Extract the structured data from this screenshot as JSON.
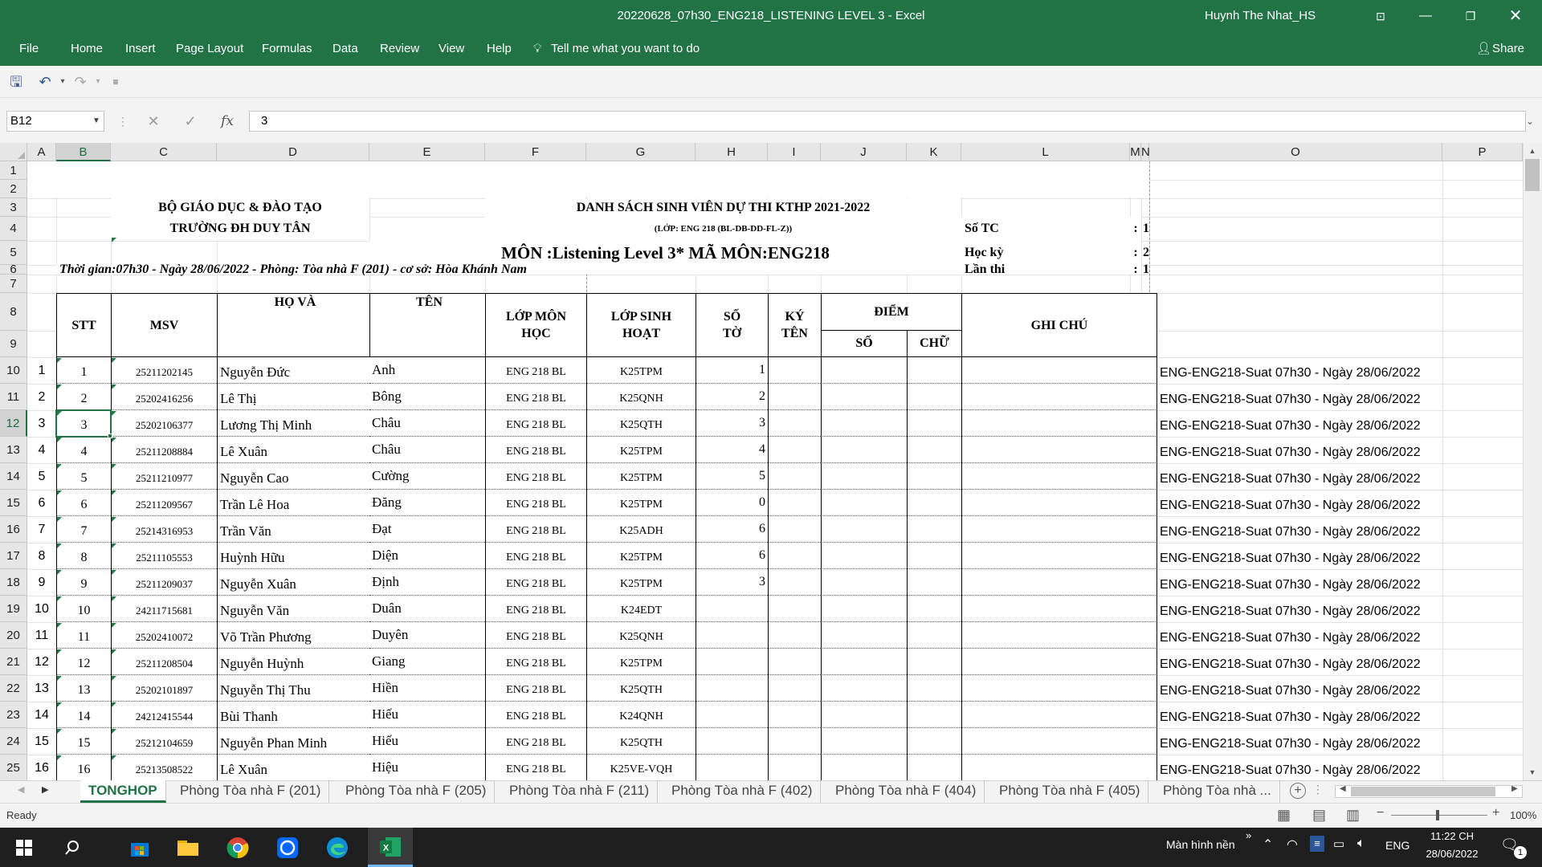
{
  "app": {
    "title": "20220628_07h30_ENG218_LISTENING LEVEL 3  -  Excel",
    "user": "Huynh The Nhat_HS",
    "share_label": "Share",
    "tabs": [
      "File",
      "Home",
      "Insert",
      "Page Layout",
      "Formulas",
      "Data",
      "Review",
      "View",
      "Help"
    ],
    "tell_me": "Tell me what you want to do"
  },
  "formula_bar": {
    "name_box": "B12",
    "formula": "3"
  },
  "columns": [
    "A",
    "B",
    "C",
    "D",
    "E",
    "F",
    "G",
    "H",
    "I",
    "J",
    "K",
    "L",
    "M",
    "N",
    "O",
    "P"
  ],
  "rows": [
    "1",
    "2",
    "3",
    "4",
    "5",
    "6",
    "7",
    "8",
    "9",
    "10",
    "11",
    "12",
    "13",
    "14",
    "15",
    "16",
    "17",
    "18",
    "19",
    "20",
    "21",
    "22",
    "23",
    "24",
    "25"
  ],
  "header": {
    "ministry": "BỘ GIÁO DỤC & ĐÀO TẠO",
    "school": "TRƯỜNG ĐH DUY TÂN",
    "list_title": "DANH SÁCH SINH VIÊN DỰ THI KTHP 2021-2022",
    "class_line": "(LỚP: ENG 218 (BL-DB-DD-FL-Z))",
    "subject": "MÔN :Listening Level 3* MÃ MÔN:ENG218",
    "time_line": "Thời gian:07h30 - Ngày 28/06/2022 - Phòng: Tòa nhà F (201) - cơ sở:  Hòa Khánh Nam",
    "so_tc_label": "Số TC",
    "so_tc_value": "1",
    "hoc_ky_label": "Học kỳ",
    "hoc_ky_value": "2",
    "lan_thi_label": "Lần thi",
    "lan_thi_value": "1",
    "colon": ":"
  },
  "table_headers": {
    "stt": "STT",
    "msv": "MSV",
    "ho_va": "HỌ VÀ",
    "ten": "TÊN",
    "lop_mon_hoc_1": "LỚP MÔN",
    "lop_mon_hoc_2": "HỌC",
    "lop_sinh_hoat_1": "LỚP SINH",
    "lop_sinh_hoat_2": "HOẠT",
    "so_to_1": "SỐ",
    "so_to_2": "TỜ",
    "ky_ten_1": "KÝ",
    "ky_ten_2": "TÊN",
    "diem": "ĐIỂM",
    "so": "SỐ",
    "chu": "CHỮ",
    "ghi_chu": "GHI CHÚ"
  },
  "students": [
    {
      "a": "1",
      "stt": "1",
      "msv": "25211202145",
      "ho": "Nguyễn Đức",
      "ten": "Anh",
      "lop": "ENG 218 BL",
      "sh": "K25TPM",
      "so_to": "1",
      "note": "ENG-ENG218-Suat 07h30 - Ngày 28/06/2022"
    },
    {
      "a": "2",
      "stt": "2",
      "msv": "25202416256",
      "ho": "Lê Thị",
      "ten": "Bông",
      "lop": "ENG 218 BL",
      "sh": "K25QNH",
      "so_to": "2",
      "note": "ENG-ENG218-Suat 07h30 - Ngày 28/06/2022"
    },
    {
      "a": "3",
      "stt": "3",
      "msv": "25202106377",
      "ho": "Lương Thị Minh",
      "ten": "Châu",
      "lop": "ENG 218 BL",
      "sh": "K25QTH",
      "so_to": "3",
      "note": "ENG-ENG218-Suat 07h30 - Ngày 28/06/2022"
    },
    {
      "a": "4",
      "stt": "4",
      "msv": "25211208884",
      "ho": "Lê Xuân",
      "ten": "Châu",
      "lop": "ENG 218 BL",
      "sh": "K25TPM",
      "so_to": "4",
      "note": "ENG-ENG218-Suat 07h30 - Ngày 28/06/2022"
    },
    {
      "a": "5",
      "stt": "5",
      "msv": "25211210977",
      "ho": "Nguyễn Cao",
      "ten": "Cường",
      "lop": "ENG 218 BL",
      "sh": "K25TPM",
      "so_to": "5",
      "note": "ENG-ENG218-Suat 07h30 - Ngày 28/06/2022"
    },
    {
      "a": "6",
      "stt": "6",
      "msv": "25211209567",
      "ho": "Trần Lê Hoa",
      "ten": "Đăng",
      "lop": "ENG 218 BL",
      "sh": "K25TPM",
      "so_to": "0",
      "note": "ENG-ENG218-Suat 07h30 - Ngày 28/06/2022"
    },
    {
      "a": "7",
      "stt": "7",
      "msv": "25214316953",
      "ho": "Trần Văn",
      "ten": "Đạt",
      "lop": "ENG 218 BL",
      "sh": "K25ADH",
      "so_to": "6",
      "note": "ENG-ENG218-Suat 07h30 - Ngày 28/06/2022"
    },
    {
      "a": "8",
      "stt": "8",
      "msv": "25211105553",
      "ho": "Huỳnh Hữu",
      "ten": "Diện",
      "lop": "ENG 218 BL",
      "sh": "K25TPM",
      "so_to": "6",
      "note": "ENG-ENG218-Suat 07h30 - Ngày 28/06/2022"
    },
    {
      "a": "9",
      "stt": "9",
      "msv": "25211209037",
      "ho": "Nguyễn Xuân",
      "ten": "Định",
      "lop": "ENG 218 BL",
      "sh": "K25TPM",
      "so_to": "3",
      "note": "ENG-ENG218-Suat 07h30 - Ngày 28/06/2022"
    },
    {
      "a": "10",
      "stt": "10",
      "msv": "24211715681",
      "ho": "Nguyễn Văn",
      "ten": "Duân",
      "lop": "ENG 218 BL",
      "sh": "K24EDT",
      "so_to": "",
      "note": "ENG-ENG218-Suat 07h30 - Ngày 28/06/2022"
    },
    {
      "a": "11",
      "stt": "11",
      "msv": "25202410072",
      "ho": "Võ Trần Phương",
      "ten": "Duyên",
      "lop": "ENG 218 BL",
      "sh": "K25QNH",
      "so_to": "",
      "note": "ENG-ENG218-Suat 07h30 - Ngày 28/06/2022"
    },
    {
      "a": "12",
      "stt": "12",
      "msv": "25211208504",
      "ho": "Nguyễn Huỳnh",
      "ten": "Giang",
      "lop": "ENG 218 BL",
      "sh": "K25TPM",
      "so_to": "",
      "note": "ENG-ENG218-Suat 07h30 - Ngày 28/06/2022"
    },
    {
      "a": "13",
      "stt": "13",
      "msv": "25202101897",
      "ho": "Nguyễn Thị Thu",
      "ten": "Hiền",
      "lop": "ENG 218 BL",
      "sh": "K25QTH",
      "so_to": "",
      "note": "ENG-ENG218-Suat 07h30 - Ngày 28/06/2022"
    },
    {
      "a": "14",
      "stt": "14",
      "msv": "24212415544",
      "ho": "Bùi Thanh",
      "ten": "Hiếu",
      "lop": "ENG 218 BL",
      "sh": "K24QNH",
      "so_to": "",
      "note": "ENG-ENG218-Suat 07h30 - Ngày 28/06/2022"
    },
    {
      "a": "15",
      "stt": "15",
      "msv": "25212104659",
      "ho": "Nguyễn Phan Minh",
      "ten": "Hiếu",
      "lop": "ENG 218 BL",
      "sh": "K25QTH",
      "so_to": "",
      "note": "ENG-ENG218-Suat 07h30 - Ngày 28/06/2022"
    },
    {
      "a": "16",
      "stt": "16",
      "msv": "25213508522",
      "ho": "Lê Xuân",
      "ten": "Hiệu",
      "lop": "ENG 218 BL",
      "sh": "K25VE-VQH",
      "so_to": "",
      "note": "ENG-ENG218-Suat 07h30 - Ngày 28/06/2022"
    }
  ],
  "sheet_tabs": [
    "TONGHOP",
    "Phòng Tòa nhà F (201)",
    "Phòng Tòa nhà F (205)",
    "Phòng Tòa nhà F (211)",
    "Phòng Tòa nhà F (402)",
    "Phòng Tòa nhà F (404)",
    "Phòng Tòa nhà F (405)",
    "Phòng Tòa nhà ..."
  ],
  "status": {
    "ready": "Ready",
    "zoom": "100%"
  },
  "taskbar": {
    "desktop_label": "Màn hình nền",
    "lang": "ENG",
    "time": "11:22 CH",
    "date": "28/06/2022",
    "notif_count": "1"
  },
  "colors": {
    "excel_green": "#217346"
  }
}
